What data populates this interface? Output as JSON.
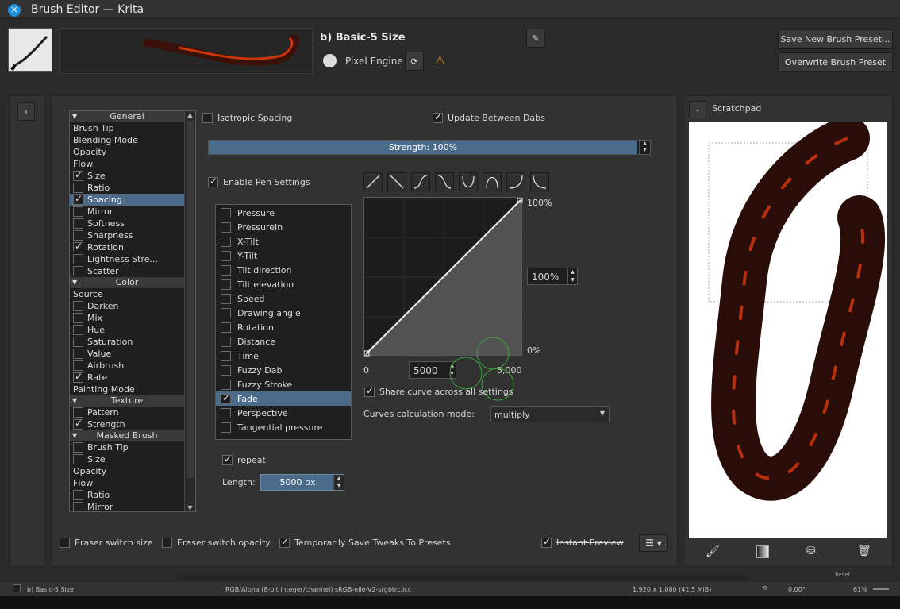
{
  "window": {
    "title": "Brush Editor — Krita",
    "close_icon": "close-icon"
  },
  "header": {
    "preset_name": "b) Basic-5 Size",
    "engine_label": "Pixel Engine",
    "save_new": "Save New Brush Preset...",
    "overwrite": "Overwrite Brush Preset"
  },
  "categories": [
    {
      "type": "head",
      "label": "General"
    },
    {
      "type": "plain",
      "label": "Brush Tip"
    },
    {
      "type": "plain",
      "label": "Blending Mode"
    },
    {
      "type": "plain",
      "label": "Opacity"
    },
    {
      "type": "plain",
      "label": "Flow"
    },
    {
      "type": "check",
      "label": "Size",
      "checked": true
    },
    {
      "type": "check",
      "label": "Ratio",
      "checked": false
    },
    {
      "type": "check",
      "label": "Spacing",
      "checked": true,
      "selected": true
    },
    {
      "type": "check",
      "label": "Mirror",
      "checked": false
    },
    {
      "type": "check",
      "label": "Softness",
      "checked": false
    },
    {
      "type": "check",
      "label": "Sharpness",
      "checked": false
    },
    {
      "type": "check",
      "label": "Rotation",
      "checked": true
    },
    {
      "type": "check",
      "label": "Lightness Stre...",
      "checked": false
    },
    {
      "type": "check",
      "label": "Scatter",
      "checked": false
    },
    {
      "type": "head",
      "label": "Color"
    },
    {
      "type": "plain",
      "label": "Source"
    },
    {
      "type": "check",
      "label": "Darken",
      "checked": false
    },
    {
      "type": "check",
      "label": "Mix",
      "checked": false
    },
    {
      "type": "check",
      "label": "Hue",
      "checked": false
    },
    {
      "type": "check",
      "label": "Saturation",
      "checked": false
    },
    {
      "type": "check",
      "label": "Value",
      "checked": false
    },
    {
      "type": "check",
      "label": "Airbrush",
      "checked": false
    },
    {
      "type": "check",
      "label": "Rate",
      "checked": true
    },
    {
      "type": "plain",
      "label": "Painting Mode"
    },
    {
      "type": "head",
      "label": "Texture"
    },
    {
      "type": "check",
      "label": "Pattern",
      "checked": false
    },
    {
      "type": "check",
      "label": "Strength",
      "checked": true
    },
    {
      "type": "head",
      "label": "Masked Brush"
    },
    {
      "type": "check",
      "label": "Brush Tip",
      "checked": false
    },
    {
      "type": "check",
      "label": "Size",
      "checked": false
    },
    {
      "type": "plain",
      "label": "Opacity"
    },
    {
      "type": "plain",
      "label": "Flow"
    },
    {
      "type": "check",
      "label": "Ratio",
      "checked": false
    },
    {
      "type": "check",
      "label": "Mirror",
      "checked": false
    }
  ],
  "spacing": {
    "isotropic": "Isotropic Spacing",
    "update_between": "Update Between Dabs",
    "strength": "Strength: 100%",
    "strength_fraction": 1.0,
    "enable_pen": "Enable Pen Settings"
  },
  "sensors": [
    {
      "label": "Pressure",
      "checked": false
    },
    {
      "label": "PressureIn",
      "checked": false
    },
    {
      "label": "X-Tilt",
      "checked": false
    },
    {
      "label": "Y-Tilt",
      "checked": false
    },
    {
      "label": "Tilt direction",
      "checked": false
    },
    {
      "label": "Tilt elevation",
      "checked": false
    },
    {
      "label": "Speed",
      "checked": false
    },
    {
      "label": "Drawing angle",
      "checked": false
    },
    {
      "label": "Rotation",
      "checked": false
    },
    {
      "label": "Distance",
      "checked": false
    },
    {
      "label": "Time",
      "checked": false
    },
    {
      "label": "Fuzzy Dab",
      "checked": false
    },
    {
      "label": "Fuzzy Stroke",
      "checked": false
    },
    {
      "label": "Fade",
      "checked": true,
      "selected": true
    },
    {
      "label": "Perspective",
      "checked": false
    },
    {
      "label": "Tangential pressure",
      "checked": false
    }
  ],
  "curve": {
    "y_max": "100%",
    "y_min": "0%",
    "x_min": "0",
    "x_max": "5,000",
    "y_value": "100%",
    "x_value": "5000",
    "share": "Share curve across all settings",
    "calc_label": "Curves calculation mode:",
    "calc_value": "multiply"
  },
  "fade": {
    "repeat": "repeat",
    "length_label": "Length:",
    "length_value": "5000 px"
  },
  "scratchpad": {
    "title": "Scratchpad"
  },
  "footer": {
    "eraser_size": "Eraser switch size",
    "eraser_opacity": "Eraser switch opacity",
    "temp_save": "Temporarily Save Tweaks To Presets",
    "instant_preview": "Instant Preview",
    "reset": "Reset"
  },
  "status": {
    "preset": "b) Basic-5 Size",
    "colorspace": "RGB/Alpha (8-bit integer/channel)  sRGB-elle-V2-srgbtrc.icc",
    "size": "1,920 x 1,080 (41.5 MiB)",
    "rotation": "0.00°",
    "zoom": "61%"
  },
  "colors": {
    "accent": "#4a6b8a",
    "bg": "#2b2b2b",
    "panel": "#323232"
  }
}
